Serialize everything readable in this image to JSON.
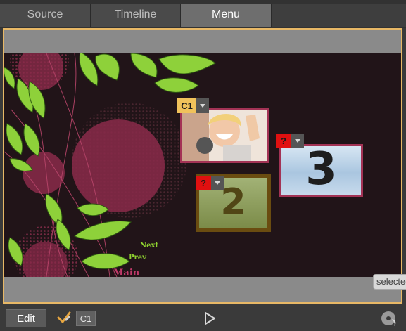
{
  "tabs": [
    {
      "label": "Source"
    },
    {
      "label": "Timeline"
    },
    {
      "label": "Menu",
      "active": true
    }
  ],
  "menu_preview": {
    "links": {
      "next": "Next",
      "prev": "Prev",
      "main": "Main"
    },
    "thumbnails": {
      "three": "3",
      "two": "2"
    },
    "badges": {
      "c1": "C1",
      "q3": "?",
      "q2": "?"
    }
  },
  "tooltip": "selected",
  "bottom_bar": {
    "edit_label": "Edit",
    "chapter_label": "C1",
    "icons": [
      "checkmark-pencil-icon",
      "play-icon",
      "disc-burn-icon"
    ]
  },
  "colors": {
    "frame_border": "#e8b866",
    "c1_badge": "#f0c25b",
    "unlinked_badge": "#e01010",
    "link_green": "#8fd230",
    "link_main": "#c03a6a"
  }
}
